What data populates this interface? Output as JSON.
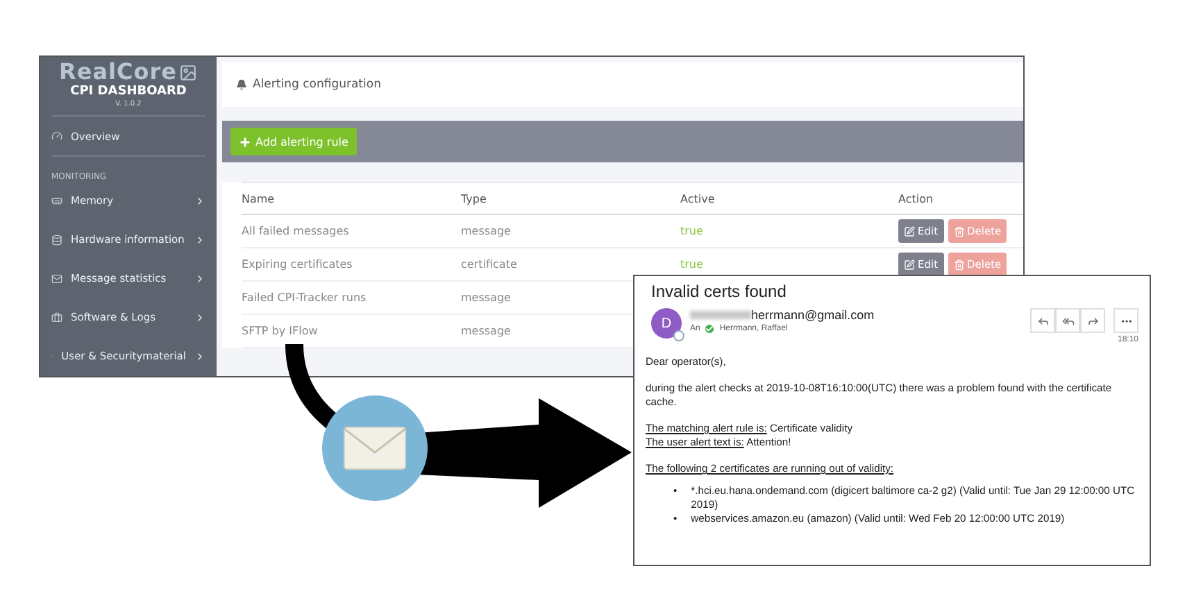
{
  "sidebar": {
    "logo": "RealCore",
    "title": "CPI DASHBOARD",
    "version": "V. 1.0.2",
    "items": [
      {
        "kind": "link",
        "label": "Overview"
      },
      {
        "kind": "section",
        "label": "MONITORING"
      },
      {
        "kind": "submenu",
        "label": "Memory"
      },
      {
        "kind": "submenu",
        "label": "Hardware information"
      },
      {
        "kind": "submenu",
        "label": "Message statistics"
      },
      {
        "kind": "submenu",
        "label": "Software & Logs"
      },
      {
        "kind": "submenu",
        "label": "User & Securitymaterial"
      }
    ]
  },
  "panel": {
    "title": "Alerting configuration",
    "add_button": "Add alerting rule",
    "columns": [
      "Name",
      "Type",
      "Active",
      "Action"
    ],
    "rows": [
      {
        "name": "All failed messages",
        "type": "message",
        "active": "true",
        "actions": [
          "Edit",
          "Delete"
        ]
      },
      {
        "name": "Expiring certificates",
        "type": "certificate",
        "active": "true",
        "actions": [
          "Edit",
          "Delete"
        ]
      },
      {
        "name": "Failed CPI-Tracker runs",
        "type": "message"
      },
      {
        "name": "SFTP by IFlow",
        "type": "message"
      }
    ]
  },
  "email": {
    "subject": "Invalid certs found",
    "avatar": "D",
    "sender": "herrmann@gmail.com",
    "to_label": "An",
    "recipient": "Herrmann, Raffael",
    "time": "18:10",
    "greeting": "Dear operator(s),",
    "intro": "during the alert checks at 2019-10-08T16:10:00(UTC) there was a problem found with the certificate cache.",
    "facts": [
      {
        "label": "The matching alert rule is:",
        "value": "Certificate validity"
      },
      {
        "label": "The user alert text is:",
        "value": "Attention!"
      }
    ],
    "list_heading": "The following 2 certificates are running out of validity:",
    "certificates": [
      {
        "bullet": "•",
        "text": "*.hci.eu.hana.ondemand.com (digicert baltimore ca-2 g2) (Valid until: Tue Jan 29 12:00:00 UTC 2019)"
      },
      {
        "bullet": "•",
        "text": "webservices.amazon.eu (amazon) (Valid until: Wed Feb 20 12:00:00 UTC 2019)"
      }
    ]
  }
}
